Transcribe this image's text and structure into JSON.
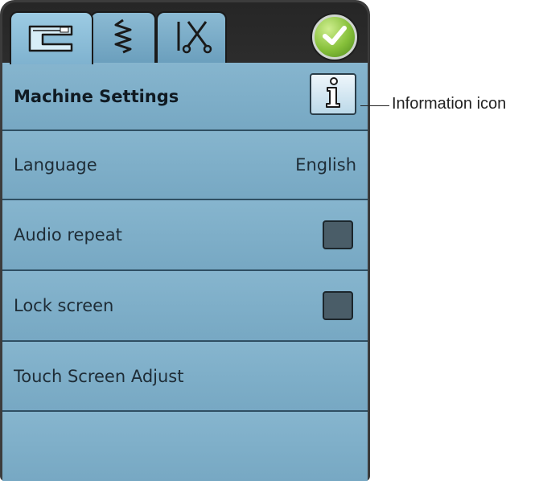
{
  "tabs": [
    {
      "name": "sewing-machine-tab",
      "icon": "sewing-machine-icon",
      "active": true
    },
    {
      "name": "stitch-tab",
      "icon": "zigzag-stitch-icon",
      "active": false
    },
    {
      "name": "tools-tab",
      "icon": "needle-scissors-icon",
      "active": false
    }
  ],
  "ok_button": {
    "icon": "checkmark-icon"
  },
  "header": {
    "title": "Machine Settings",
    "info_icon": "info-icon"
  },
  "rows": {
    "language": {
      "label": "Language",
      "value": "English"
    },
    "audio_repeat": {
      "label": "Audio repeat",
      "checked": false
    },
    "lock_screen": {
      "label": "Lock screen",
      "checked": false
    },
    "touch_screen": {
      "label": "Touch Screen Adjust"
    }
  },
  "callout": {
    "text": "Information icon"
  },
  "colors": {
    "panel": "#7eaec8",
    "frame": "#2c2c2c",
    "ok": "#86c03a"
  }
}
